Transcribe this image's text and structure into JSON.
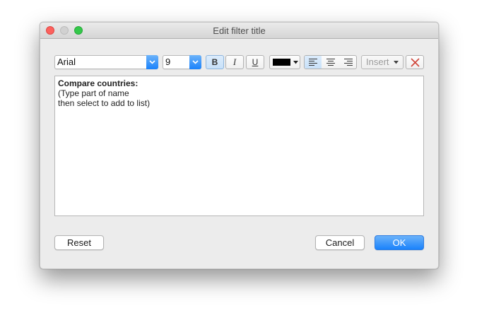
{
  "window": {
    "title": "Edit filter title"
  },
  "toolbar": {
    "font": {
      "value": "Arial"
    },
    "size": {
      "value": "9"
    },
    "bold_label": "B",
    "italic_label": "I",
    "underline_label": "U",
    "text_color": "#000000",
    "alignment": "left",
    "insert_label": "Insert"
  },
  "editor": {
    "lines": [
      "Compare countries:",
      "(Type part of name",
      "then select to add to list)"
    ]
  },
  "buttons": {
    "reset": "Reset",
    "cancel": "Cancel",
    "ok": "OK"
  },
  "colors": {
    "accent": "#1a82fb",
    "clear_icon": "#d0453a"
  }
}
